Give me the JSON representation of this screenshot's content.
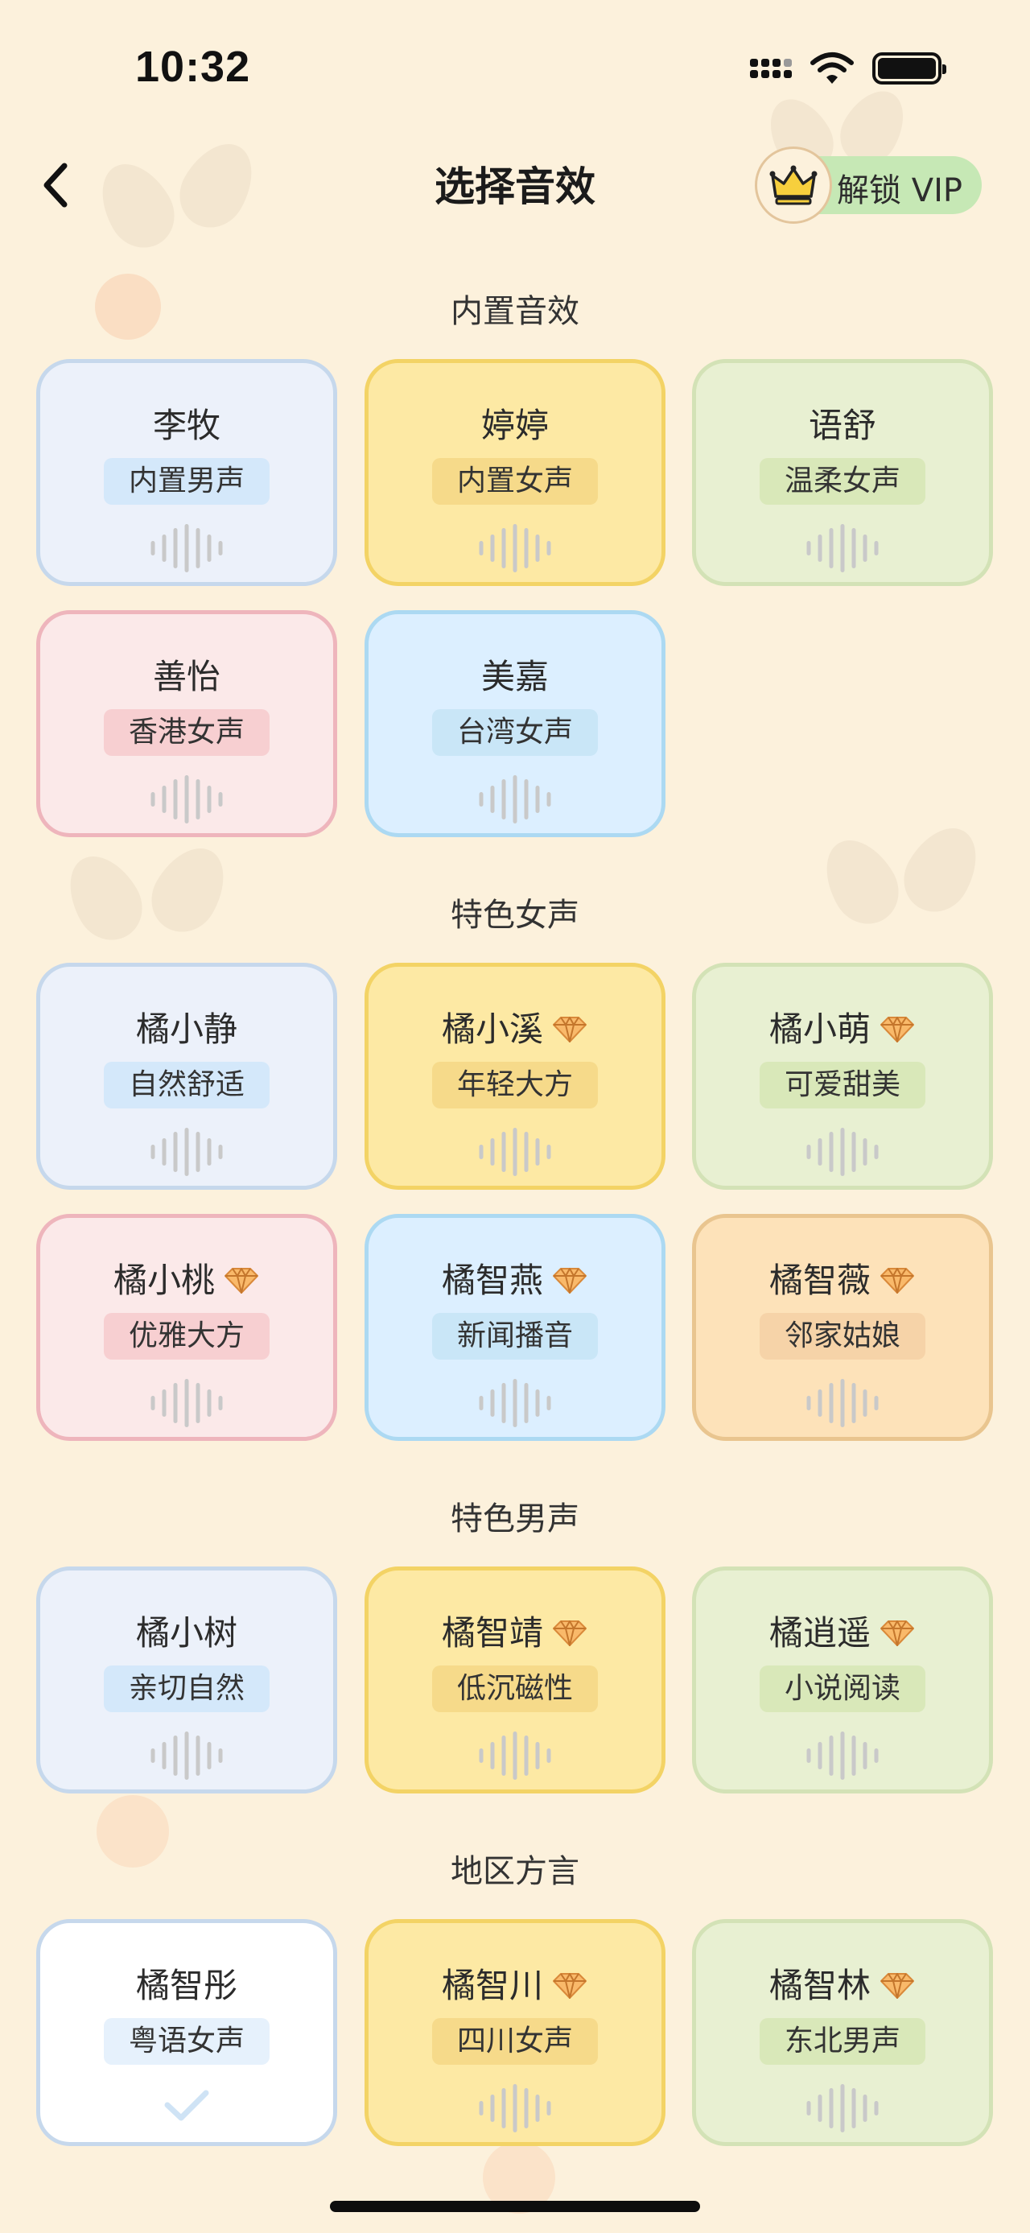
{
  "status_bar": {
    "time": "10:32"
  },
  "nav": {
    "title": "选择音效",
    "vip_label": "解锁 VIP"
  },
  "sections": [
    {
      "title": "内置音效",
      "cards": [
        {
          "name": "李牧",
          "tag": "内置男声",
          "color": "blue",
          "premium": false
        },
        {
          "name": "婷婷",
          "tag": "内置女声",
          "color": "yellow",
          "premium": false
        },
        {
          "name": "语舒",
          "tag": "温柔女声",
          "color": "green",
          "premium": false
        },
        {
          "name": "善怡",
          "tag": "香港女声",
          "color": "pink",
          "premium": false
        },
        {
          "name": "美嘉",
          "tag": "台湾女声",
          "color": "cyan",
          "premium": false
        }
      ]
    },
    {
      "title": "特色女声",
      "cards": [
        {
          "name": "橘小静",
          "tag": "自然舒适",
          "color": "blue",
          "premium": false
        },
        {
          "name": "橘小溪",
          "tag": "年轻大方",
          "color": "yellow",
          "premium": true
        },
        {
          "name": "橘小萌",
          "tag": "可爱甜美",
          "color": "green",
          "premium": true
        },
        {
          "name": "橘小桃",
          "tag": "优雅大方",
          "color": "pink",
          "premium": true
        },
        {
          "name": "橘智燕",
          "tag": "新闻播音",
          "color": "cyan",
          "premium": true
        },
        {
          "name": "橘智薇",
          "tag": "邻家姑娘",
          "color": "orange",
          "premium": true
        }
      ]
    },
    {
      "title": "特色男声",
      "cards": [
        {
          "name": "橘小树",
          "tag": "亲切自然",
          "color": "blue",
          "premium": false
        },
        {
          "name": "橘智靖",
          "tag": "低沉磁性",
          "color": "yellow",
          "premium": true
        },
        {
          "name": "橘逍遥",
          "tag": "小说阅读",
          "color": "green",
          "premium": true
        }
      ]
    },
    {
      "title": "地区方言",
      "cards": [
        {
          "name": "橘智彤",
          "tag": "粤语女声",
          "color": "white",
          "premium": false,
          "selected": true
        },
        {
          "name": "橘智川",
          "tag": "四川女声",
          "color": "yellow",
          "premium": true
        },
        {
          "name": "橘智林",
          "tag": "东北男声",
          "color": "green",
          "premium": true
        }
      ]
    }
  ],
  "icons": {
    "back": "chevron-left-icon",
    "vip": "crown-icon",
    "premium": "diamond-icon",
    "sound": "sound-wave-icon",
    "selected": "checkmark-icon"
  },
  "colors": {
    "background": "#fcf1dc",
    "vip_pill": "#c6e8b5",
    "card_blue": "#ecf1fa",
    "card_yellow": "#fde9a4",
    "card_green": "#e8f0d2",
    "card_pink": "#fbe9e9",
    "card_cyan": "#dcefff",
    "card_orange": "#fde2b9",
    "card_selected": "#ffffff"
  }
}
